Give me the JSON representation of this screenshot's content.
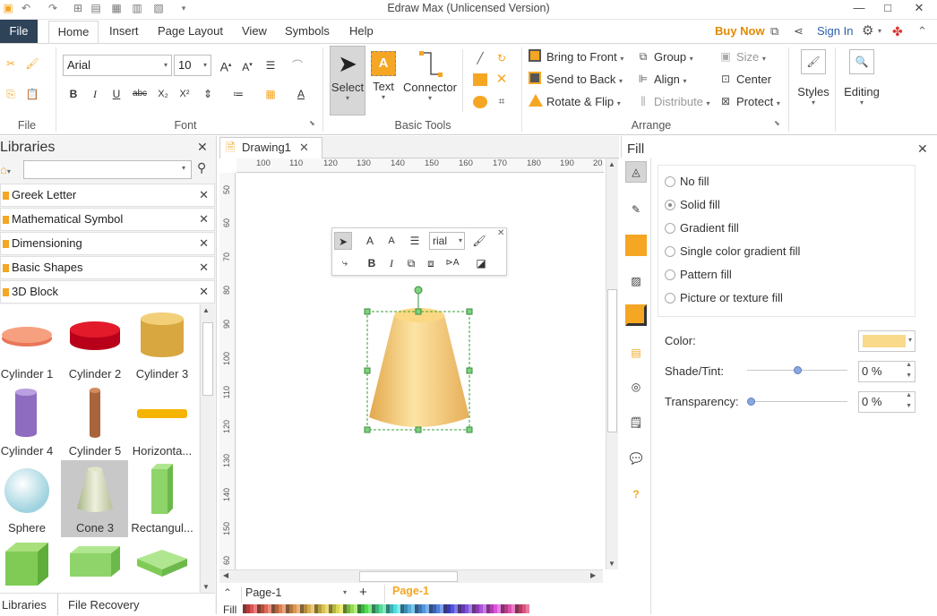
{
  "app": {
    "title": "Edraw Max (Unlicensed Version)"
  },
  "menubar": {
    "tabs": [
      "File",
      "Home",
      "Insert",
      "Page Layout",
      "View",
      "Symbols",
      "Help"
    ],
    "buy_now": "Buy Now",
    "sign_in": "Sign In"
  },
  "ribbon": {
    "file_group_label": "File",
    "font_group_label": "Font",
    "basic_tools_label": "Basic Tools",
    "arrange_label": "Arrange",
    "font_name": "Arial",
    "font_size": "10",
    "select_label": "Select",
    "text_label": "Text",
    "connector_label": "Connector",
    "bring_to_front": "Bring to Front",
    "send_to_back": "Send to Back",
    "rotate_flip": "Rotate & Flip",
    "group": "Group",
    "align": "Align",
    "distribute": "Distribute",
    "size": "Size",
    "center": "Center",
    "protect": "Protect",
    "styles": "Styles",
    "editing": "Editing"
  },
  "libraries": {
    "title": "Libraries",
    "items": [
      "Greek Letter",
      "Mathematical Symbol",
      "Dimensioning",
      "Basic Shapes",
      "3D Block"
    ],
    "shapes": [
      {
        "label": "Cylinder 1"
      },
      {
        "label": "Cylinder 2"
      },
      {
        "label": "Cylinder 3"
      },
      {
        "label": "Cylinder 4"
      },
      {
        "label": "Cylinder 5"
      },
      {
        "label": "Horizonta..."
      },
      {
        "label": "Sphere"
      },
      {
        "label": "Cone 3"
      },
      {
        "label": "Rectangul..."
      }
    ],
    "bottom_tabs": [
      "Libraries",
      "File Recovery"
    ]
  },
  "document": {
    "tab": "Drawing1",
    "ruler_h": [
      "100",
      "110",
      "120",
      "130",
      "140",
      "150",
      "160",
      "170",
      "180",
      "190",
      "20"
    ],
    "ruler_v": [
      "50",
      "60",
      "70",
      "80",
      "90",
      "100",
      "110",
      "120",
      "130",
      "140",
      "150",
      "60"
    ],
    "mini_font": "rial",
    "page_selector": "Page-1",
    "active_page": "Page-1",
    "fill_label": "Fill"
  },
  "fill": {
    "title": "Fill",
    "options": [
      "No fill",
      "Solid fill",
      "Gradient fill",
      "Single color gradient fill",
      "Pattern fill",
      "Picture or texture fill"
    ],
    "selected": "Solid fill",
    "color_label": "Color:",
    "color_value": "#f9d98a",
    "shade_label": "Shade/Tint:",
    "shade_value": "0 %",
    "transparency_label": "Transparency:",
    "transparency_value": "0 %"
  },
  "colors": {
    "accent": "#f5a623",
    "file_tab": "#2e4258",
    "link": "#2b5fad",
    "buy": "#e08a00"
  }
}
